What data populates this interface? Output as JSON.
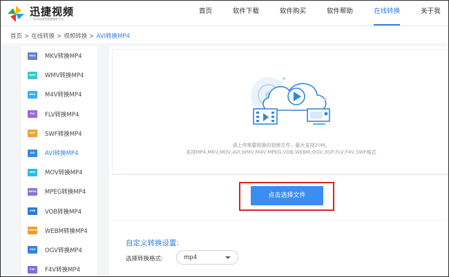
{
  "header": {
    "logo_text": "迅捷视频",
    "logo_sub": "一站式在线音视频服务平台",
    "nav": [
      {
        "label": "首页",
        "active": false
      },
      {
        "label": "软件下载",
        "active": false
      },
      {
        "label": "软件购买",
        "active": false
      },
      {
        "label": "软件帮助",
        "active": false
      },
      {
        "label": "在线转换",
        "active": true
      },
      {
        "label": "关于我",
        "active": false
      }
    ]
  },
  "breadcrumb": {
    "items": [
      "首页",
      "在线转换",
      "视频转换"
    ],
    "separator": ">",
    "current": "AVI转换MP4"
  },
  "sidebar": {
    "items": [
      {
        "badge": "MKV",
        "label": "MKV转换MP4",
        "color": "#6a7fc9",
        "active": false
      },
      {
        "badge": "WMV",
        "label": "WMV转换MP4",
        "color": "#3bc6c6",
        "active": false
      },
      {
        "badge": "M4V",
        "label": "M4V转换MP4",
        "color": "#3aaee8",
        "active": false
      },
      {
        "badge": "FLV",
        "label": "FLV转换MP4",
        "color": "#9b6ad6",
        "active": false
      },
      {
        "badge": "SWF",
        "label": "SWF转换MP4",
        "color": "#f2a233",
        "active": false
      },
      {
        "badge": "AVI",
        "label": "AVI转换MP4",
        "color": "#2f8fe6",
        "active": true
      },
      {
        "badge": "MOV",
        "label": "MOV转换MP4",
        "color": "#2dbbe0",
        "active": false
      },
      {
        "badge": "MPEG",
        "label": "MPEG转换MP4",
        "color": "#8a74d8",
        "active": false
      },
      {
        "badge": "VOB",
        "label": "VOB转换MP4",
        "color": "#2a7be0",
        "active": false
      },
      {
        "badge": "WEBM",
        "label": "WEBM转换MP4",
        "color": "#f29a2a",
        "active": false
      },
      {
        "badge": "OGV",
        "label": "OGV转换MP4",
        "color": "#2d83e6",
        "active": false
      },
      {
        "badge": "F4V",
        "label": "F4V转换MP4",
        "color": "#7b6ee0",
        "active": false
      }
    ]
  },
  "upload": {
    "tip_line1": "请上传需要转换的视频文件，最大支持20M。",
    "tip_line2": "支持MP4,MKV,MOV,AVI,WMV,M4V,MPEG,VOB,WEBM,OGV,3GP,FLV,F4V,SWF格式",
    "button_label": "点击选择文件",
    "icon": "cloud-video-upload-icon"
  },
  "settings": {
    "title": "自定义转换设置:",
    "format_label": "选择转换格式:",
    "format_value": "mp4"
  },
  "colors": {
    "accent": "#2f7fdd",
    "button": "#3a8ef0",
    "highlight_outline": "#e02020"
  }
}
